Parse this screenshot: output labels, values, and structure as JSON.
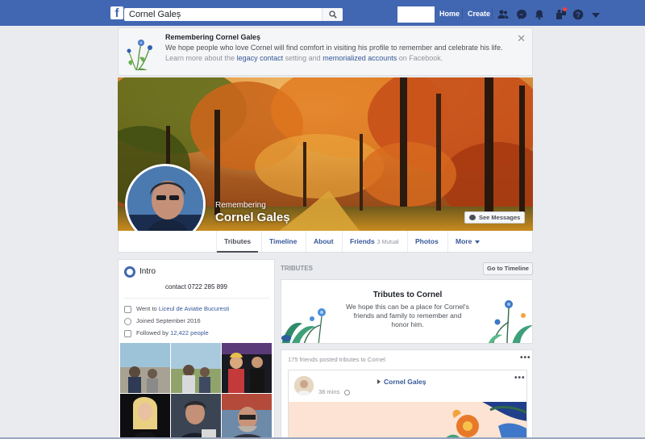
{
  "topbar": {
    "logo": "f",
    "search_value": "Cornel Galeș",
    "home": "Home",
    "create": "Create",
    "icons": [
      "search-icon",
      "friends-icon",
      "messenger-icon",
      "notifications-icon",
      "quick-help-icon",
      "help-icon",
      "account-menu-icon"
    ],
    "accent": "#4267b2"
  },
  "banner": {
    "title": "Remembering Cornel Galeș",
    "text": "We hope people who love Cornel will find comfort in visiting his profile to remember and celebrate his life.",
    "learn_prefix": "Learn more about the",
    "legacy_link": "legacy contact",
    "learn_middle": "setting and",
    "memorialized_link": "memorialized accounts",
    "learn_suffix": "on Facebook.",
    "close": "✕"
  },
  "profile": {
    "remembering": "Remembering",
    "name": "Cornel Galeș",
    "see_messages": "See Messages"
  },
  "tabs": [
    {
      "label": "Tributes"
    },
    {
      "label": "Timeline"
    },
    {
      "label": "About"
    },
    {
      "label": "Friends",
      "sub": "3 Mutual"
    },
    {
      "label": "Photos"
    },
    {
      "label": "More"
    }
  ],
  "intro": {
    "title": "Intro",
    "bio": "contact 0722 285 899",
    "went_prefix": "Went to",
    "school": "Liceul de Aviatie Bucuresti",
    "joined": "Joined September 2016",
    "followed_prefix": "Followed by",
    "followers": "12,422 people"
  },
  "tributes": {
    "section_label": "TRIBUTES",
    "goto_timeline": "Go to Timeline",
    "card_title": "Tributes to Cornel",
    "card_text": "We hope this can be a place for Cornel's friends and family to remember and honor him.",
    "friends_posted": "175 friends posted tributes to Cornel",
    "more": "•••",
    "post_author": "Cornel Galeș",
    "post_time": "38 mins"
  }
}
